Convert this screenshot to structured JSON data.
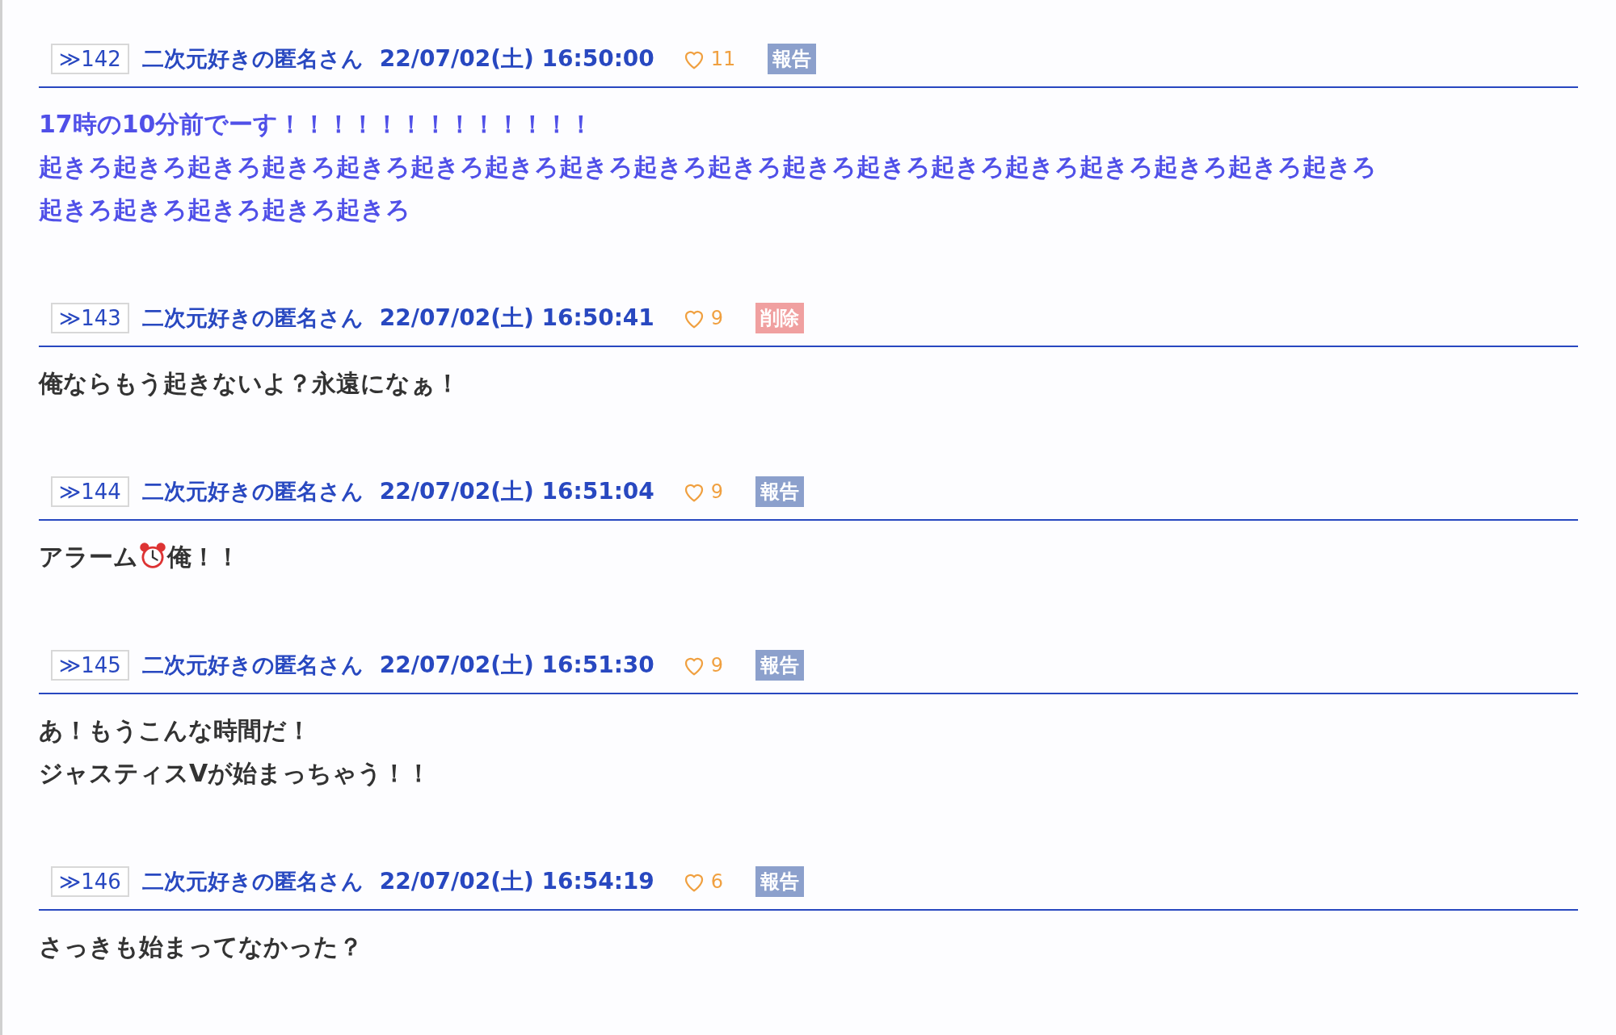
{
  "posts": [
    {
      "number": "≫142",
      "name": "二次元好きの匿名さん",
      "date": "22/07/02(土) 16:50:00",
      "likes": "11",
      "action": {
        "kind": "report",
        "label": "報告"
      },
      "color": "#5050e8",
      "body": [
        [
          {
            "kind": "text",
            "text": "17時の10分前でーす！！！！！！！！！！！！！"
          }
        ],
        [
          {
            "kind": "text",
            "text": "起きろ起きろ起きろ起きろ起きろ起きろ起きろ起きろ起きろ起きろ起きろ起きろ起きろ起きろ起きろ起きろ起きろ起きろ"
          }
        ],
        [
          {
            "kind": "text",
            "text": "起きろ起きろ起きろ起きろ起きろ"
          }
        ]
      ]
    },
    {
      "number": "≫143",
      "name": "二次元好きの匿名さん",
      "date": "22/07/02(土) 16:50:41",
      "likes": "9",
      "action": {
        "kind": "delete",
        "label": "削除"
      },
      "color": "#333333",
      "body": [
        [
          {
            "kind": "text",
            "text": "俺ならもう起きないよ？永遠になぁ！"
          }
        ]
      ]
    },
    {
      "number": "≫144",
      "name": "二次元好きの匿名さん",
      "date": "22/07/02(土) 16:51:04",
      "likes": "9",
      "action": {
        "kind": "report",
        "label": "報告"
      },
      "color": "#333333",
      "body": [
        [
          {
            "kind": "text",
            "text": "アラーム"
          },
          {
            "kind": "icon"
          },
          {
            "kind": "text",
            "text": "俺！！"
          }
        ]
      ]
    },
    {
      "number": "≫145",
      "name": "二次元好きの匿名さん",
      "date": "22/07/02(土) 16:51:30",
      "likes": "9",
      "action": {
        "kind": "report",
        "label": "報告"
      },
      "color": "#333333",
      "body": [
        [
          {
            "kind": "text",
            "text": "あ！もうこんな時間だ！"
          }
        ],
        [
          {
            "kind": "text",
            "text": "ジャスティスVが始まっちゃう！！"
          }
        ]
      ]
    },
    {
      "number": "≫146",
      "name": "二次元好きの匿名さん",
      "date": "22/07/02(土) 16:54:19",
      "likes": "6",
      "action": {
        "kind": "report",
        "label": "報告"
      },
      "color": "#333333",
      "body": [
        [
          {
            "kind": "text",
            "text": "さっきも始まってなかった？"
          }
        ]
      ]
    }
  ]
}
